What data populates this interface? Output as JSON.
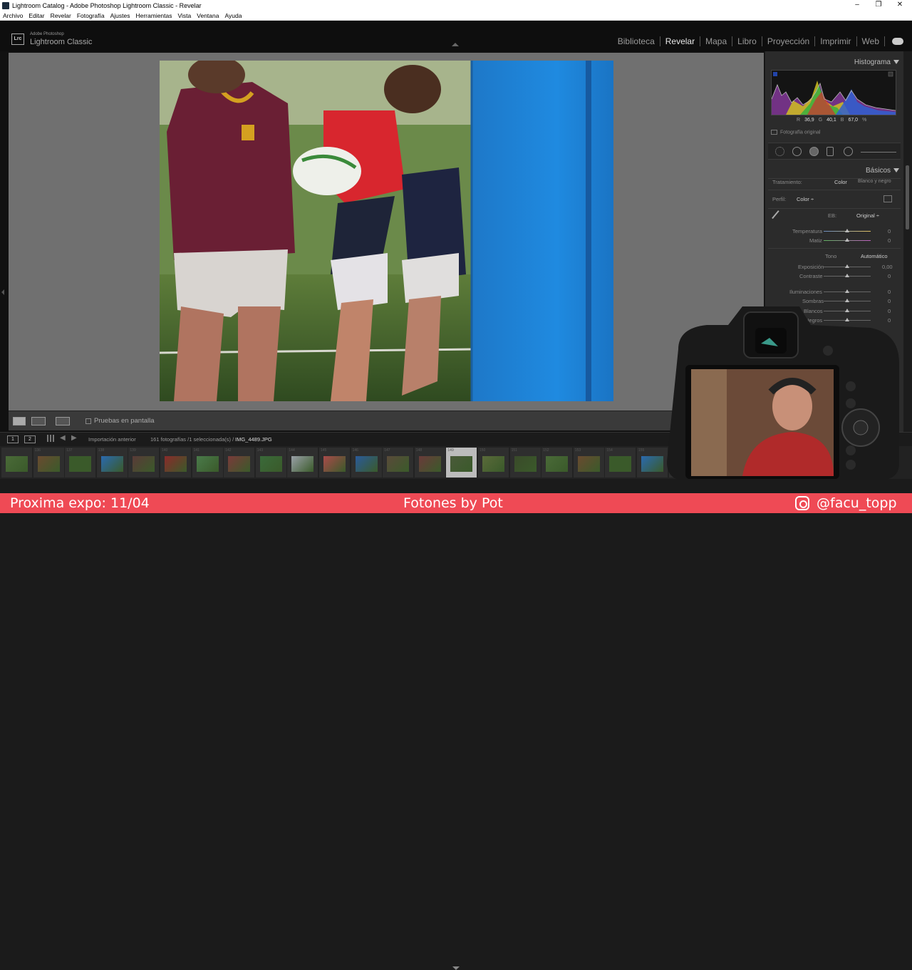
{
  "window": {
    "title": "Lightroom Catalog - Adobe Photoshop Lightroom Classic - Revelar"
  },
  "menu": [
    "Archivo",
    "Editar",
    "Revelar",
    "Fotografía",
    "Ajustes",
    "Herramientas",
    "Vista",
    "Ventana",
    "Ayuda"
  ],
  "brand": {
    "line1": "Adobe Photoshop",
    "line2": "Lightroom Classic",
    "logo": "Lrc"
  },
  "modules": [
    "Biblioteca",
    "Revelar",
    "Mapa",
    "Libro",
    "Proyección",
    "Imprimir",
    "Web"
  ],
  "active_module": "Revelar",
  "histogram": {
    "title": "Histograma",
    "r_label": "R",
    "r_value": "36,9",
    "g_label": "G",
    "g_value": "40,1",
    "b_label": "B",
    "b_value": "67,0",
    "unit": "%",
    "original": "Fotografía original"
  },
  "basics": {
    "title": "Básicos",
    "treatment_label": "Tratamiento:",
    "treatment_color": "Color",
    "treatment_bw": "Blanco y negro",
    "profile_label": "Perfil:",
    "profile_value": "Color ÷",
    "wb_label": "EB:",
    "wb_value": "Original ÷",
    "temp_label": "Temperatura",
    "temp_value": "0",
    "tint_label": "Matiz",
    "tint_value": "0",
    "tone_label": "Tono",
    "auto_label": "Automático",
    "exposure_label": "Exposición",
    "exposure_value": "0,00",
    "contrast_label": "Contraste",
    "contrast_value": "0",
    "highlights_label": "Iluminaciones",
    "highlights_value": "0",
    "shadows_label": "Sombras",
    "shadows_value": "0",
    "whites_label": "Blancos",
    "whites_value": "0",
    "blacks_label": "Negros",
    "blacks_value": "0"
  },
  "toolbar": {
    "proof_label": "Pruebas en pantalla"
  },
  "filmbar": {
    "page1": "1",
    "page2": "2",
    "source": "Importación anterior",
    "count": "161 fotografías /1 seleccionada(s) /",
    "filename": "IMG_4489.JPG"
  },
  "filmstrip": {
    "numbers": [
      "",
      "136",
      "137",
      "138",
      "139",
      "140",
      "141",
      "142",
      "143",
      "144",
      "145",
      "146",
      "147",
      "148",
      "149",
      "150",
      "151",
      "152",
      "153",
      "154",
      "155",
      "156"
    ],
    "selected_index": 14
  },
  "banner": {
    "left": "Proxima expo: 11/04",
    "center": "Fotones by Pot",
    "right": "@facu_topp",
    "color": "#ef4a55"
  }
}
